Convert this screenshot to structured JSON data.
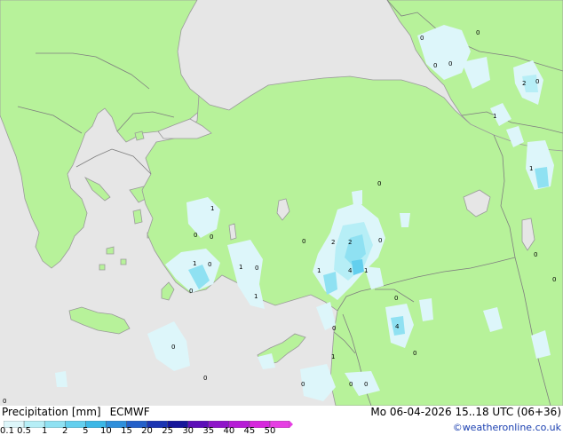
{
  "header": {
    "title": "Precipitation [mm]",
    "model": "ECMWF",
    "valid_time": "Mo 06-04-2026 15..18 UTC (06+36)",
    "credit": "©weatheronline.co.uk"
  },
  "colors": {
    "sea": "#e6e6e6",
    "land": "#b7f29a",
    "coast": "#9a9a9a",
    "border": "#7f7f7f"
  },
  "legend": {
    "ticks": [
      "0.1",
      "0.5",
      "1",
      "2",
      "5",
      "10",
      "15",
      "20",
      "25",
      "30",
      "35",
      "40",
      "45",
      "50"
    ],
    "colors": [
      "#ddf6fa",
      "#b6eef6",
      "#8fe1f2",
      "#63cfee",
      "#3cb7e6",
      "#2f8fdb",
      "#2460c9",
      "#1b35b2",
      "#16169a",
      "#5d0fb8",
      "#8f16c9",
      "#b61cd6",
      "#d627dc",
      "#e63fe3"
    ]
  },
  "map": {
    "labels": [
      {
        "text": "0"
      },
      {
        "text": "0"
      },
      {
        "text": "0"
      },
      {
        "text": "0"
      },
      {
        "text": "2"
      },
      {
        "text": "0"
      },
      {
        "text": "1"
      },
      {
        "text": "1"
      },
      {
        "text": "0"
      },
      {
        "text": "1"
      },
      {
        "text": "0"
      },
      {
        "text": "0"
      },
      {
        "text": "1"
      },
      {
        "text": "0"
      },
      {
        "text": "1"
      },
      {
        "text": "0"
      },
      {
        "text": "0"
      },
      {
        "text": "2"
      },
      {
        "text": "2"
      },
      {
        "text": "0"
      },
      {
        "text": "1"
      },
      {
        "text": "4"
      },
      {
        "text": "1"
      },
      {
        "text": "0"
      },
      {
        "text": "1"
      },
      {
        "text": "0"
      },
      {
        "text": "0"
      },
      {
        "text": "0"
      },
      {
        "text": "4"
      },
      {
        "text": "0"
      },
      {
        "text": "0"
      },
      {
        "text": "0"
      },
      {
        "text": "0"
      },
      {
        "text": "1"
      },
      {
        "text": "0"
      },
      {
        "text": "0"
      },
      {
        "text": "0"
      },
      {
        "text": "0"
      }
    ]
  }
}
